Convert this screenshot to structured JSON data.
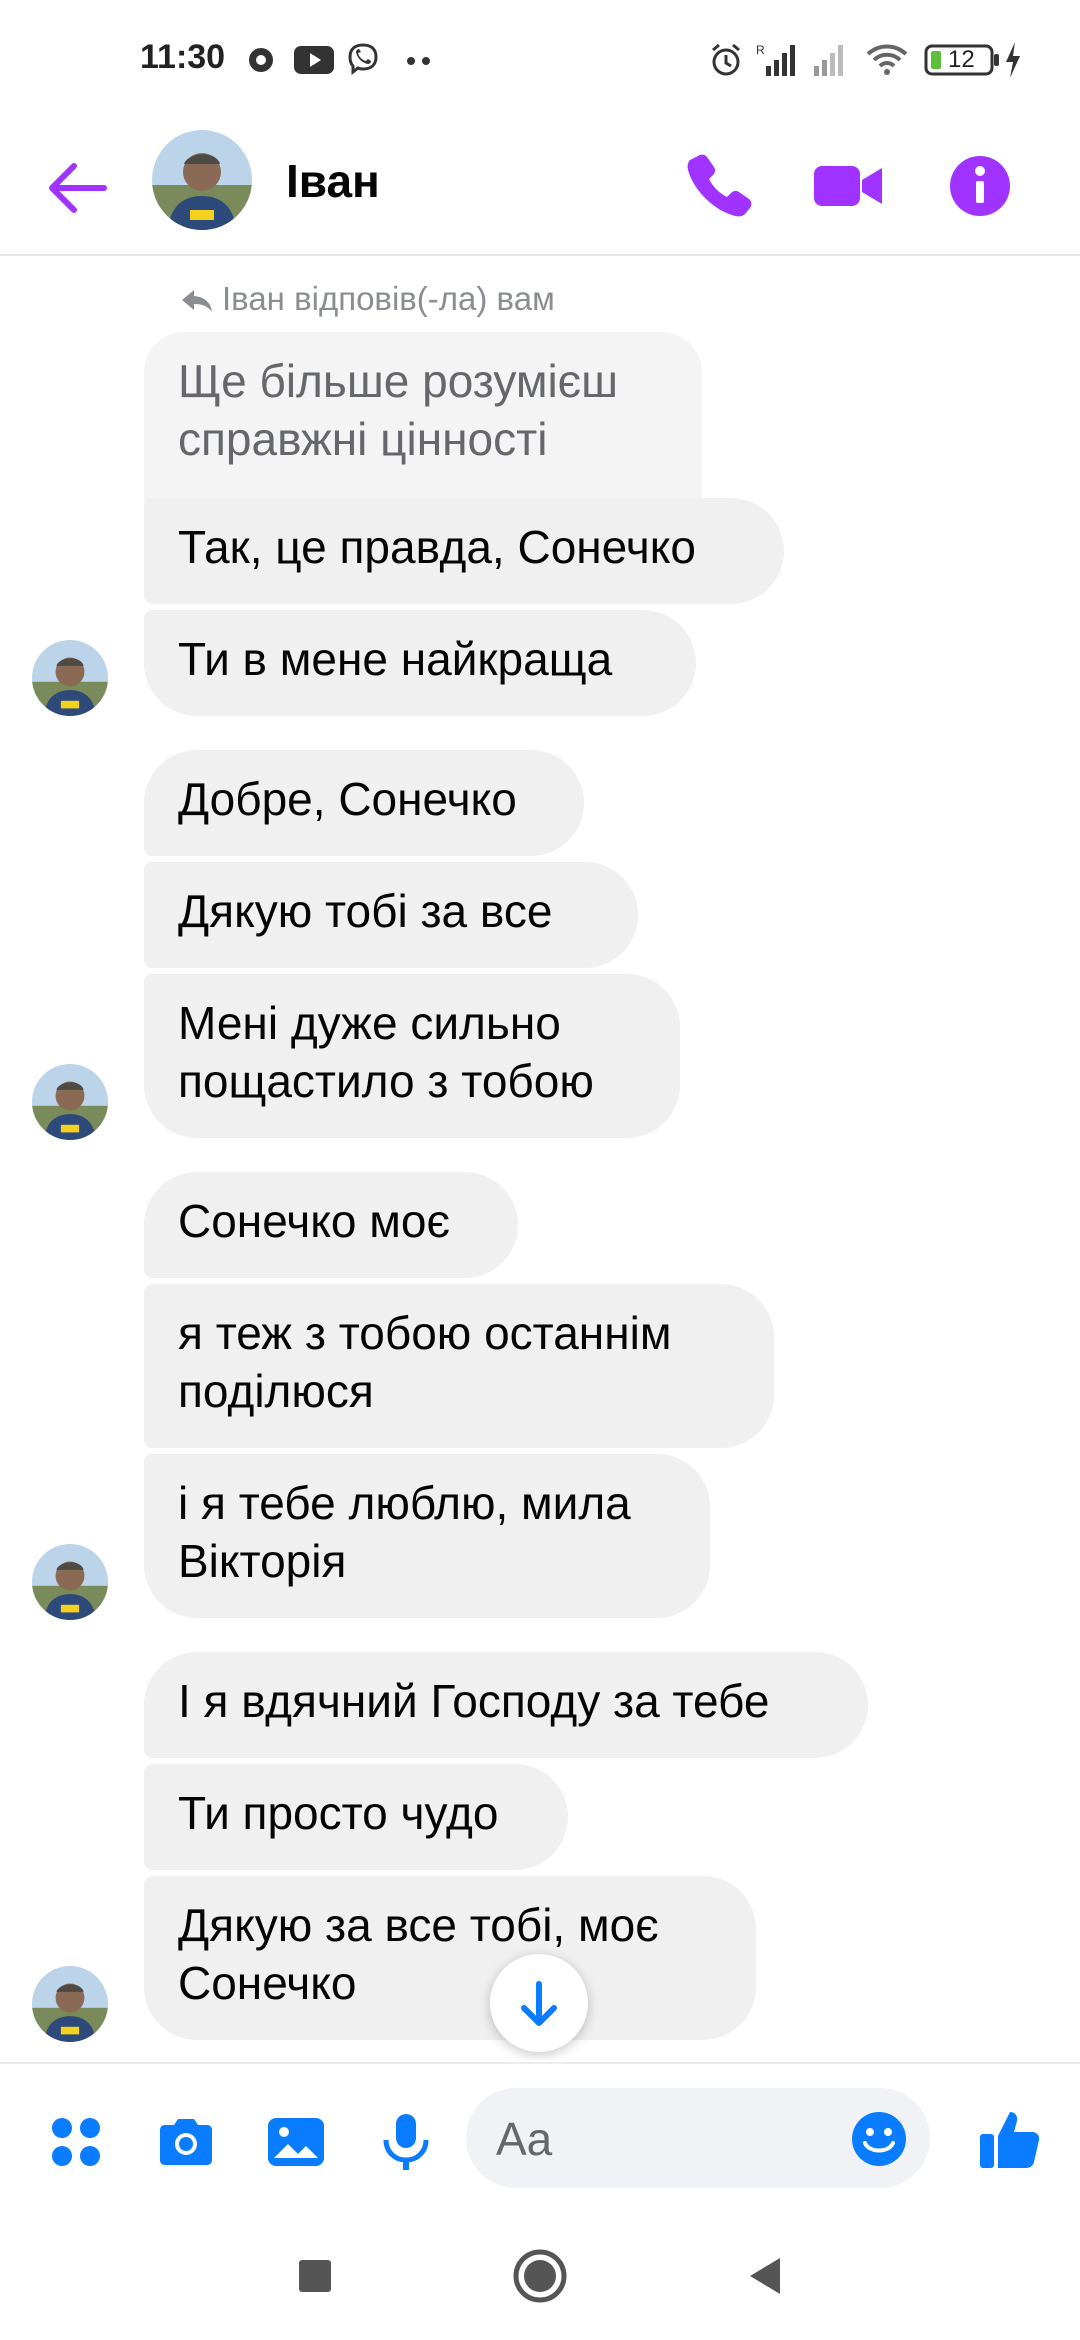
{
  "status_bar": {
    "time": "11:30",
    "battery": "12",
    "icons": [
      "alarm-icon",
      "signal-icon",
      "signal-icon",
      "wifi-icon",
      "battery-icon",
      "charging-icon",
      "youtube-icon",
      "viber-icon"
    ]
  },
  "header": {
    "contact_name": "Іван",
    "icons": [
      "back-arrow-icon",
      "phone-icon",
      "video-camera-icon",
      "info-icon"
    ],
    "accent_color": "#a033ff"
  },
  "conversation": {
    "reply_note": "Іван відповів(-ла) вам",
    "quoted_message": "Ще більше розумієш справжні цінності",
    "messages": [
      "Так, це правда, Сонечко",
      "Ти в мене найкраща",
      "Добре, Сонечко",
      "Дякую тобі за все",
      "Мені дуже сильно пощастило з тобою",
      "Сонечко моє",
      "я теж з тобою останнім поділюся",
      "і я тебе люблю, мила Вікторія",
      "І я вдячний Господу за тебе",
      "Ти просто чудо",
      "Дякую за все тобі, моє Сонечко"
    ]
  },
  "composer": {
    "placeholder": "Aa",
    "icons": [
      "apps-grid-icon",
      "camera-icon",
      "gallery-icon",
      "microphone-icon",
      "emoji-icon",
      "thumbs-up-icon"
    ],
    "accent_color": "#0a7cff"
  },
  "nav_bar": {
    "icons": [
      "recents-square-icon",
      "home-circle-icon",
      "back-triangle-icon"
    ]
  }
}
